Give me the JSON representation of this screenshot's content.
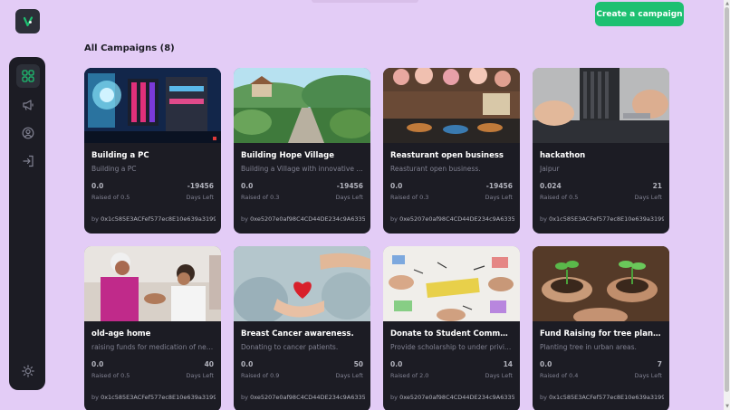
{
  "header": {
    "create_button_label": "Create a campaign"
  },
  "section": {
    "title": "All Campaigns (8)"
  },
  "sidebar": {
    "items": [
      {
        "icon": "dashboard-icon",
        "active": true
      },
      {
        "icon": "megaphone-icon",
        "active": false
      },
      {
        "icon": "profile-icon",
        "active": false
      },
      {
        "icon": "logout-icon",
        "active": false
      },
      {
        "icon": "sun-icon",
        "active": false
      }
    ]
  },
  "campaigns": [
    {
      "title": "Building a PC",
      "description": "Building a PC",
      "raised": "0.0",
      "raised_label": "Raised of 0.5",
      "days": "-19456",
      "days_label": "Days Left",
      "by": "by",
      "owner": "0x1c585E3ACFef577ec8E10e639a319978..."
    },
    {
      "title": "Building Hope Village",
      "description": "Building a Village with innovative ide...",
      "raised": "0.0",
      "raised_label": "Raised of 0.3",
      "days": "-19456",
      "days_label": "Days Left",
      "by": "by",
      "owner": "0xe5207e0af98C4CD44DE234c9A633502..."
    },
    {
      "title": "Reasturant open business",
      "description": "Reasturant open business.",
      "raised": "0.0",
      "raised_label": "Raised of 0.3",
      "days": "-19456",
      "days_label": "Days Left",
      "by": "by",
      "owner": "0xe5207e0af98C4CD44DE234c9A633502..."
    },
    {
      "title": "hackathon",
      "description": "Jaipur",
      "raised": "0.024",
      "raised_label": "Raised of 0.5",
      "days": "21",
      "days_label": "Days Left",
      "by": "by",
      "owner": "0x1c585E3ACFef577ec8E10e639a319978..."
    },
    {
      "title": "old-age home",
      "description": "raising funds for medication of neig...",
      "raised": "0.0",
      "raised_label": "Raised of 0.5",
      "days": "40",
      "days_label": "Days Left",
      "by": "by",
      "owner": "0x1c585E3ACFef577ec8E10e639a319978..."
    },
    {
      "title": "Breast Cancer awareness.",
      "description": "Donating to cancer patients.",
      "raised": "0.0",
      "raised_label": "Raised of 0.9",
      "days": "50",
      "days_label": "Days Left",
      "by": "by",
      "owner": "0xe5207e0af98C4CD44DE234c9A633502..."
    },
    {
      "title": "Donate to Student Community.",
      "description": "Provide scholarship to under privile...",
      "raised": "0.0",
      "raised_label": "Raised of 2.0",
      "days": "14",
      "days_label": "Days Left",
      "by": "by",
      "owner": "0xe5207e0af98C4CD44DE234c9A633502..."
    },
    {
      "title": "Fund Raising for tree plantati...",
      "description": "Planting tree in urban areas.",
      "raised": "0.0",
      "raised_label": "Raised of 0.4",
      "days": "7",
      "days_label": "Days Left",
      "by": "by",
      "owner": "0x1c585E3ACFef577ec8E10e639a319978..."
    }
  ],
  "colors": {
    "background": "#e3ccf6",
    "card": "#1c1c24",
    "accent": "#1dc071",
    "muted_text": "#808191"
  }
}
